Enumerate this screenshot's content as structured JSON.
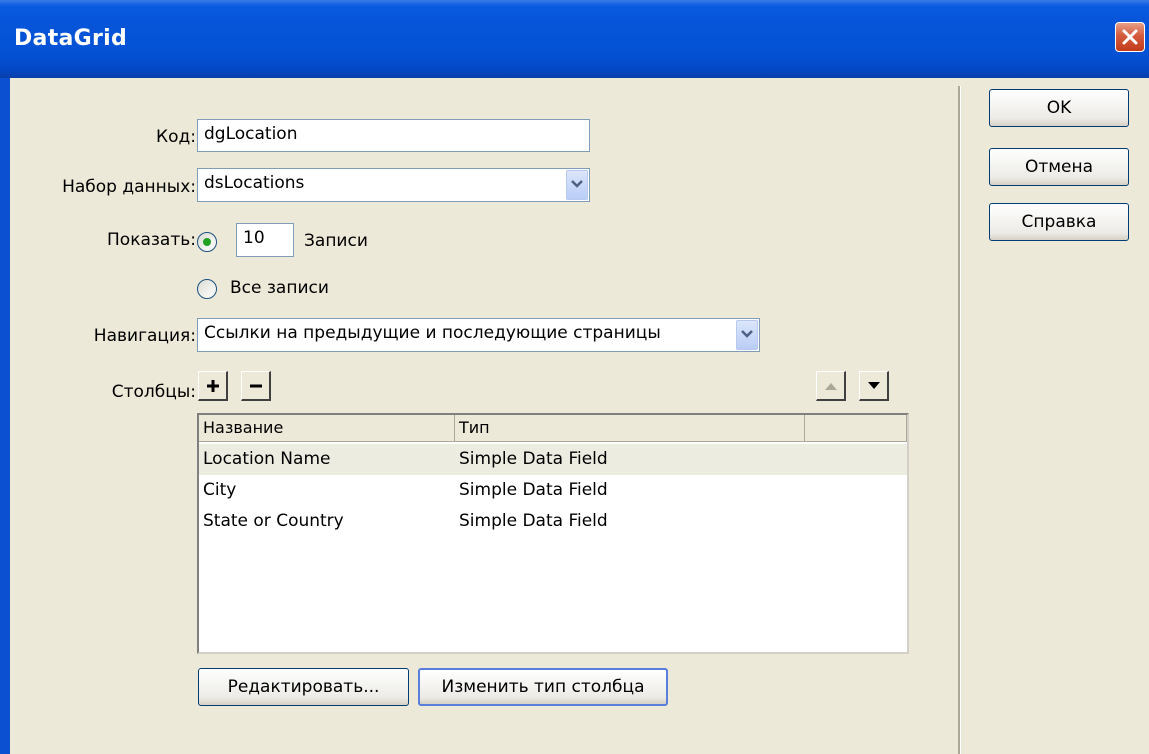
{
  "window": {
    "title": "DataGrid",
    "close_icon": "close-icon"
  },
  "form": {
    "id_label": "Код:",
    "id_value": "dgLocation",
    "dataset_label": "Набор данных:",
    "dataset_value": "dsLocations",
    "show_label": "Показать:",
    "records_count": "10",
    "records_suffix": "Записи",
    "all_records_label": "Все записи",
    "show_mode": "records",
    "navigation_label": "Навигация:",
    "navigation_value": "Ссылки на предыдущие и последующие страницы",
    "columns_label": "Столбцы:"
  },
  "grid": {
    "headers": [
      "Название",
      "Тип",
      ""
    ],
    "rows": [
      {
        "name": "Location Name",
        "type": "Simple Data Field",
        "selected": true
      },
      {
        "name": "City",
        "type": "Simple Data Field",
        "selected": false
      },
      {
        "name": "State or Country",
        "type": "Simple Data Field",
        "selected": false
      }
    ]
  },
  "buttons": {
    "edit": "Редактировать...",
    "change_type": "Изменить тип столбца",
    "ok": "OK",
    "cancel": "Отмена",
    "help": "Справка"
  }
}
